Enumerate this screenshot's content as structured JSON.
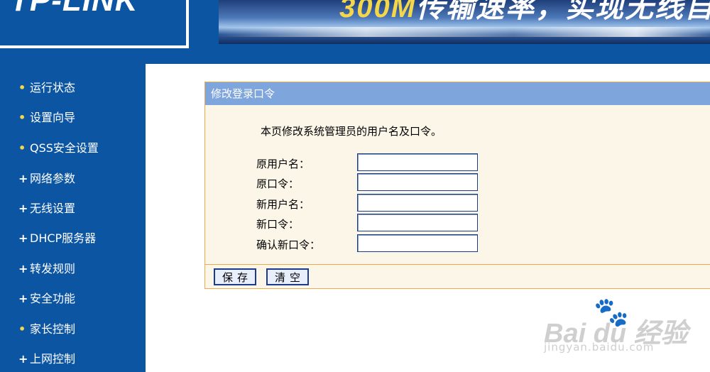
{
  "header": {
    "logo": "TP-LINK",
    "banner_speed": "300M",
    "banner_slogan": "传输速率，实现无线自由",
    "colors": {
      "header_blue": "#0b55a3",
      "banner_yellow": "#f3d64a"
    }
  },
  "sidebar": {
    "items": [
      {
        "label": "运行状态",
        "marker": "•",
        "icon": "bullet-icon"
      },
      {
        "label": "设置向导",
        "marker": "•",
        "icon": "bullet-icon"
      },
      {
        "label": "QSS安全设置",
        "marker": "•",
        "icon": "bullet-icon"
      },
      {
        "label": "网络参数",
        "marker": "+",
        "icon": "expand-plus-icon"
      },
      {
        "label": "无线设置",
        "marker": "+",
        "icon": "expand-plus-icon"
      },
      {
        "label": "DHCP服务器",
        "marker": "+",
        "icon": "expand-plus-icon"
      },
      {
        "label": "转发规则",
        "marker": "+",
        "icon": "expand-plus-icon"
      },
      {
        "label": "安全功能",
        "marker": "+",
        "icon": "expand-plus-icon"
      },
      {
        "label": "家长控制",
        "marker": "•",
        "icon": "bullet-icon"
      },
      {
        "label": "上网控制",
        "marker": "+",
        "icon": "expand-plus-icon"
      }
    ]
  },
  "panel": {
    "title": "修改登录口令",
    "description": "本页修改系统管理员的用户名及口令。",
    "fields": [
      {
        "label": "原用户名：",
        "value": ""
      },
      {
        "label": "原口令：",
        "value": ""
      },
      {
        "label": "新用户名：",
        "value": ""
      },
      {
        "label": "新口令：",
        "value": ""
      },
      {
        "label": "确认新口令：",
        "value": ""
      }
    ],
    "save_label": "保存",
    "clear_label": "清空",
    "colors": {
      "title_bar": "#7ea5dc",
      "panel_bg": "#fbf6e8",
      "border": "#f0a94b"
    }
  },
  "watermark": {
    "brand": "Bai du 经验",
    "url": "jingyan.baidu.com"
  }
}
